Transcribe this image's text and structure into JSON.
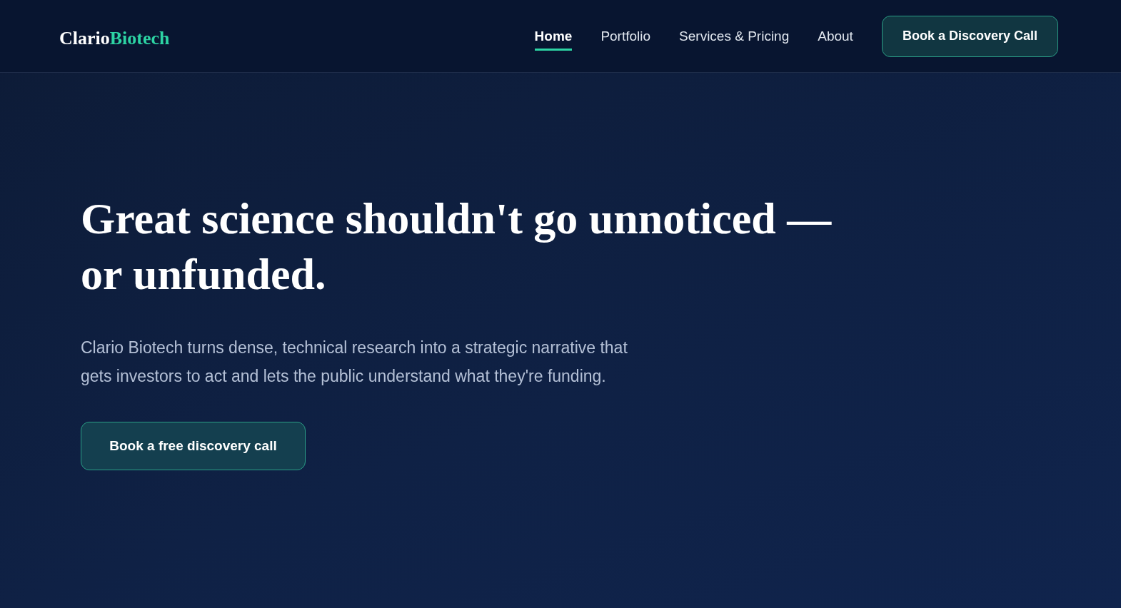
{
  "header": {
    "logo": {
      "name": "Clario",
      "accent": "Biotech"
    },
    "nav": [
      {
        "label": "Home",
        "selected": true
      },
      {
        "label": "Portfolio",
        "selected": false
      },
      {
        "label": "Services & Pricing",
        "selected": false
      },
      {
        "label": "About",
        "selected": false
      }
    ],
    "cta": "Book a Discovery Call"
  },
  "hero": {
    "title": "Great science shouldn't go unnoticed — or unfunded.",
    "text": "Clario Biotech turns dense, technical research into a strategic narrative that gets investors to act and lets the public understand what they're funding.",
    "button": "Book a free discovery call"
  }
}
